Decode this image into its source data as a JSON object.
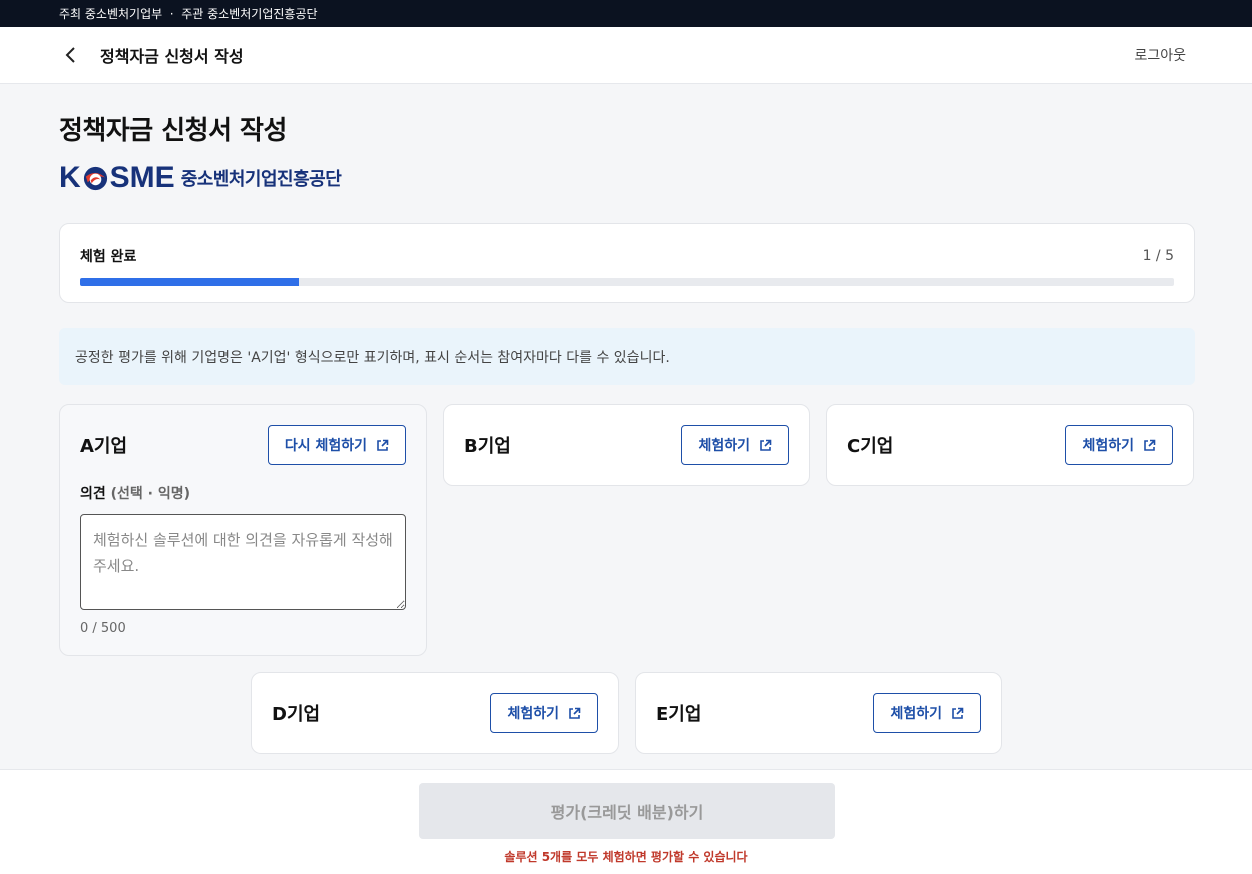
{
  "topbar": {
    "text": "주최 중소벤처기업부  ·  주관 중소벤처기업진흥공단"
  },
  "header": {
    "title": "정책자금 신청서 작성",
    "logout": "로그아웃"
  },
  "page": {
    "title": "정책자금 신청서 작성"
  },
  "logo": {
    "mark_left": "K",
    "mark_right": "SME",
    "subtitle": "중소벤처기업진흥공단"
  },
  "progress": {
    "label": "체험 완료",
    "count": "1 / 5",
    "fraction": 0.2
  },
  "notice": {
    "text": "공정한 평가를 위해 기업명은 'A기업' 형식으로만 표기하며, 표시 순서는 참여자마다 다를 수 있습니다."
  },
  "companies": [
    {
      "name": "A기업",
      "button": "다시 체험하기"
    },
    {
      "name": "B기업",
      "button": "체험하기"
    },
    {
      "name": "C기업",
      "button": "체험하기"
    },
    {
      "name": "D기업",
      "button": "체험하기"
    },
    {
      "name": "E기업",
      "button": "체험하기"
    }
  ],
  "opinion": {
    "label": "의견",
    "label_sub": "(선택 · 익명)",
    "placeholder": "체험하신 솔루션에 대한 의견을 자유롭게 작성해 주세요.",
    "value": "",
    "count": "0 / 500"
  },
  "footer": {
    "submit_label": "평가(크레딧 배분)하기",
    "warning": "솔루션 5개를 모두 체험하면 평가할 수 있습니다"
  },
  "colors": {
    "accent": "#2f6fe8",
    "brand": "#17327a",
    "button_border": "#1e4fa8",
    "warning": "#c0392b",
    "notice_bg": "#eaf4fb"
  }
}
